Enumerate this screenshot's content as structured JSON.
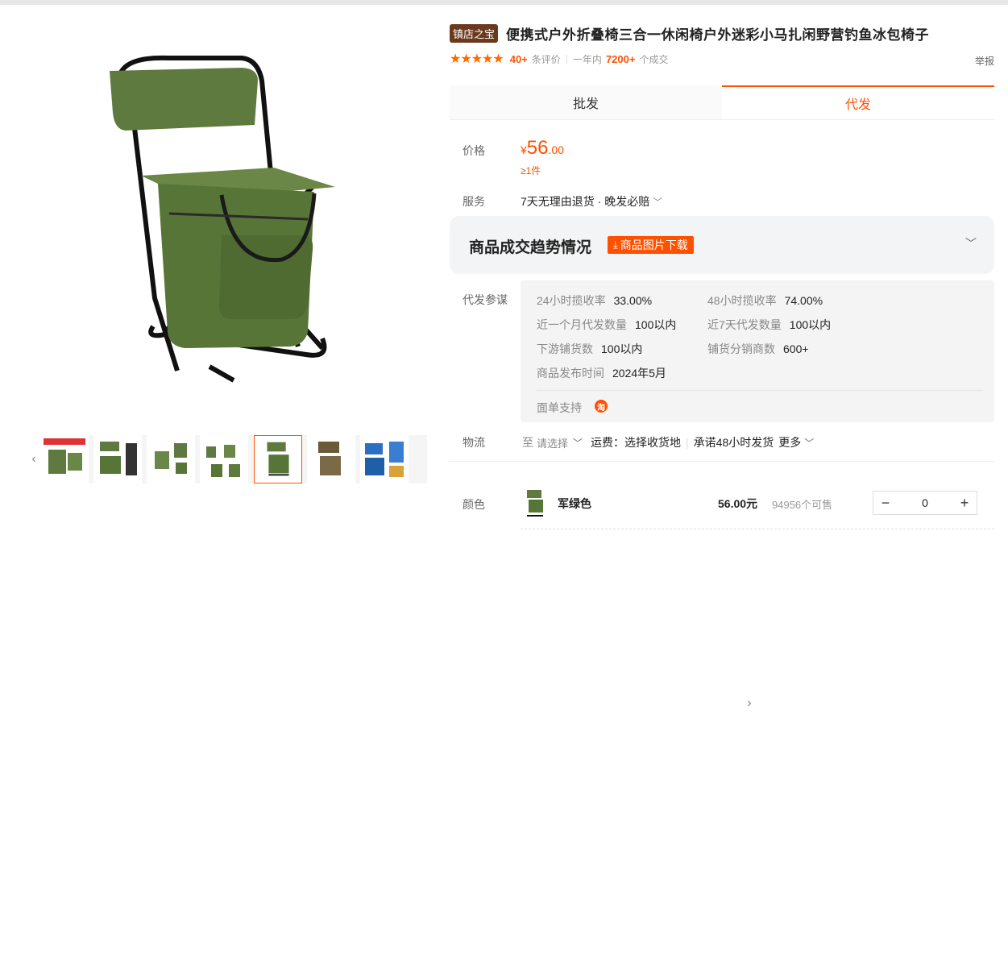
{
  "product": {
    "badge": "镇店之宝",
    "title": "便携式户外折叠椅三合一休闲椅户外迷彩小马扎闲野营钓鱼冰包椅子",
    "stars": "★★★★★",
    "review_count": "40+",
    "review_label": "条评价",
    "year_label": "一年内",
    "sales_count": "7200+",
    "sales_label": "个成交",
    "report": "举报"
  },
  "tabs": {
    "wholesale": "批发",
    "dropship": "代发"
  },
  "price": {
    "label": "价格",
    "currency": "¥",
    "integer": "56",
    "decimal": ".00",
    "min_qty": "≥1件"
  },
  "service": {
    "label": "服务",
    "value": "7天无理由退货 · 晚发必赔"
  },
  "trend": {
    "title": "商品成交趋势情况",
    "download": "商品图片下载"
  },
  "dropship_ref": {
    "label": "代发参谋",
    "stats": [
      {
        "k": "24小时揽收率",
        "v": "33.00%"
      },
      {
        "k": "48小时揽收率",
        "v": "74.00%"
      },
      {
        "k": "近一个月代发数量",
        "v": "100以内"
      },
      {
        "k": "近7天代发数量",
        "v": "100以内"
      },
      {
        "k": "下游铺货数",
        "v": "100以内"
      },
      {
        "k": "铺货分销商数",
        "v": "600+"
      },
      {
        "k": "商品发布时间",
        "v": "2024年5月"
      }
    ],
    "waybill_label": "面单支持",
    "taobao_glyph": "淘"
  },
  "logistics": {
    "label": "物流",
    "to": "至",
    "select": "请选择",
    "fee": "运费：选择收货地",
    "promise": "承诺48小时发货",
    "more": "更多"
  },
  "sku": {
    "label": "颜色",
    "name": "军绿色",
    "price": "56.00元",
    "stock": "94956个可售",
    "qty": "0",
    "minus": "−",
    "plus": "+"
  },
  "colors": {
    "accent": "#ff5000",
    "badge": "#6b3a1e",
    "chair_green": "#5c7a3e"
  }
}
